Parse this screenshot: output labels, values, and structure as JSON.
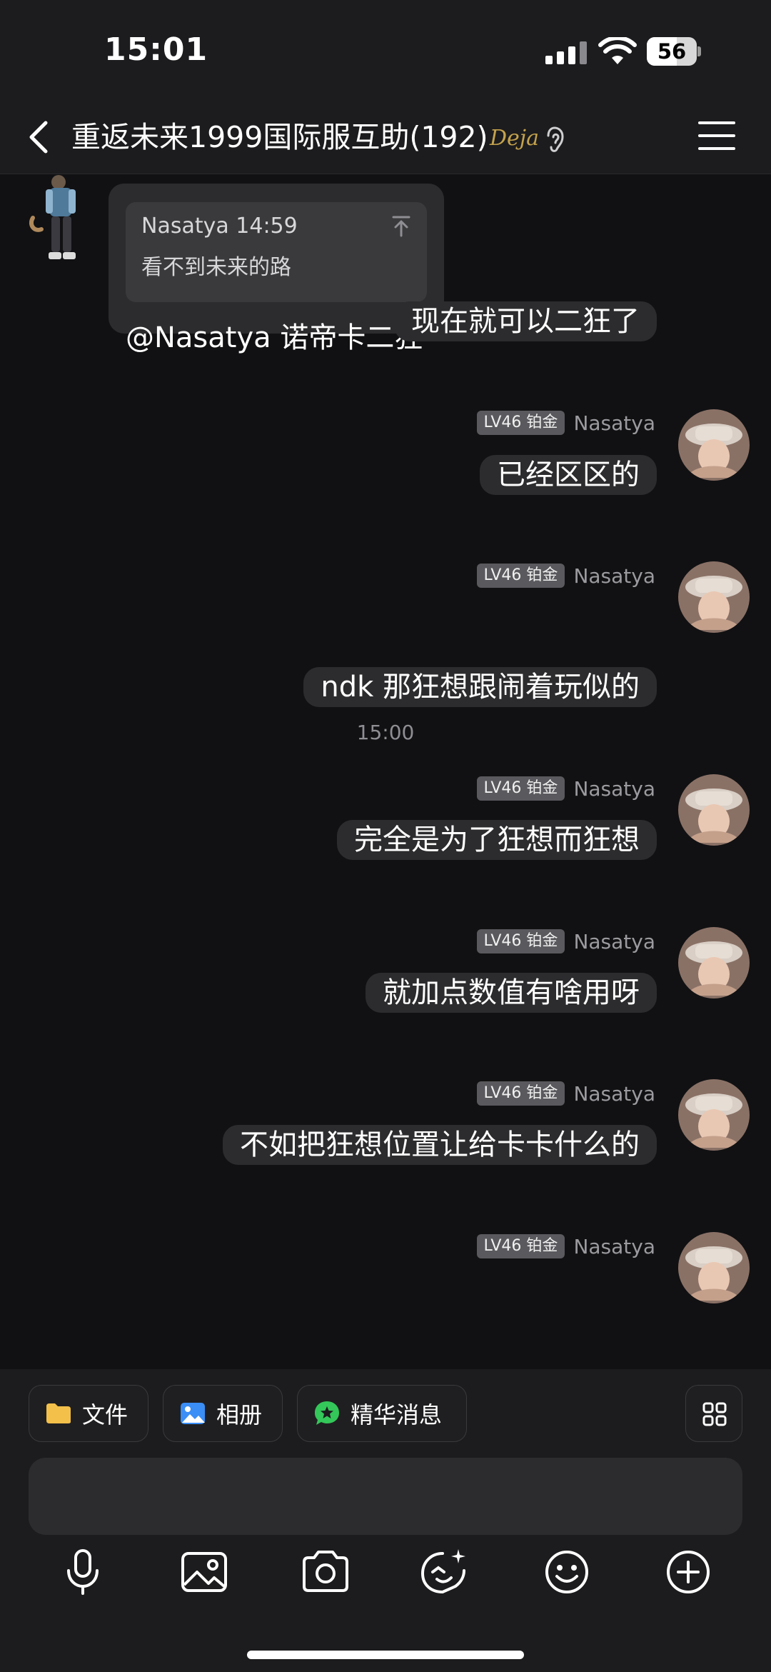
{
  "status_bar": {
    "time": "15:01",
    "battery": "56"
  },
  "header": {
    "title": "重返未来1999国际服互助(192)",
    "badge": "Deja"
  },
  "quoted_message": {
    "quote_sender_time": "Nasatya 14:59",
    "quote_text": "看不到未来的路",
    "reply_text": "@Nasatya 诺帝卡二狂"
  },
  "messages": [
    {
      "level": "LV46 铂金",
      "name": "Nasatya",
      "text": "现在就可以二狂了"
    },
    {
      "level": "LV46 铂金",
      "name": "Nasatya",
      "text": "已经区区的"
    },
    {
      "level": "LV46 铂金",
      "name": "Nasatya",
      "text": "ndk 那狂想跟闹着玩似的"
    },
    {
      "level": "LV46 铂金",
      "name": "Nasatya",
      "text": "完全是为了狂想而狂想"
    },
    {
      "level": "LV46 铂金",
      "name": "Nasatya",
      "text": "就加点数值有啥用呀"
    },
    {
      "level": "LV46 铂金",
      "name": "Nasatya",
      "text": "不如把狂想位置让给卡卡什么的"
    }
  ],
  "timestamp": "15:00",
  "quick_actions": {
    "file": "文件",
    "album": "相册",
    "featured": "精华消息"
  },
  "colors": {
    "bg": "#111113",
    "panel": "#1c1c1e",
    "bubble": "#2c2c2e",
    "gold": "#c4a24d",
    "folder": "#f3c04a",
    "album": "#3a8ef6",
    "featured": "#34c759"
  },
  "toolbar_icons": [
    "microphone-icon",
    "image-icon",
    "camera-icon",
    "sticker-icon",
    "emoji-icon",
    "plus-icon"
  ]
}
